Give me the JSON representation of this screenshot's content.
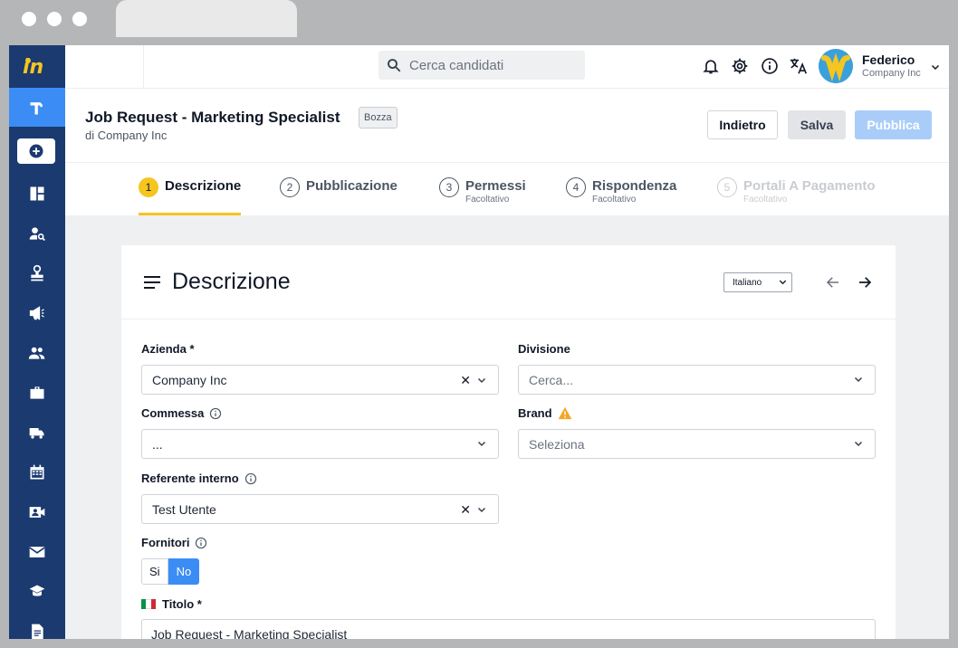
{
  "header": {
    "title": "Job Request - Marketing Specialist",
    "status": "Bozza",
    "subtitle": "di Company Inc",
    "buttons": {
      "back": "Indietro",
      "save": "Salva",
      "publish": "Pubblica"
    }
  },
  "topbar": {
    "search_placeholder": "Cerca candidati",
    "user_name": "Federico",
    "user_company": "Company Inc"
  },
  "steps": [
    {
      "num": "1",
      "label": "Descrizione",
      "sublabel": "",
      "state": "active"
    },
    {
      "num": "2",
      "label": "Pubblicazione",
      "sublabel": "",
      "state": "normal"
    },
    {
      "num": "3",
      "label": "Permessi",
      "sublabel": "Facoltativo",
      "state": "normal"
    },
    {
      "num": "4",
      "label": "Rispondenza",
      "sublabel": "Facoltativo",
      "state": "normal"
    },
    {
      "num": "5",
      "label": "Portali A Pagamento",
      "sublabel": "Facoltativo",
      "state": "disabled"
    }
  ],
  "card": {
    "title": "Descrizione",
    "language": "Italiano"
  },
  "form": {
    "azienda": {
      "label": "Azienda *",
      "value": "Company Inc"
    },
    "divisione": {
      "label": "Divisione",
      "placeholder": "Cerca..."
    },
    "commessa": {
      "label": "Commessa",
      "value": "..."
    },
    "brand": {
      "label": "Brand",
      "placeholder": "Seleziona"
    },
    "referente": {
      "label": "Referente interno",
      "value": "Test Utente"
    },
    "fornitori": {
      "label": "Fornitori",
      "option_yes": "Si",
      "option_no": "No",
      "selected": "No"
    },
    "titolo": {
      "label": "Titolo *",
      "value": "Job Request - Marketing Specialist"
    }
  },
  "colors": {
    "sidebar": "#1b3a70",
    "accent": "#3b8df5",
    "step_active": "#f5c520",
    "warning": "#f5a623"
  },
  "icons": {
    "sidebar": [
      "logo-icon",
      "hammer-icon",
      "add-icon",
      "dashboard-icon",
      "search-user-icon",
      "stamp-icon",
      "megaphone-icon",
      "people-icon",
      "briefcase-icon",
      "truck-icon",
      "calendar-icon",
      "video-contact-icon",
      "mail-icon",
      "school-icon",
      "document-icon"
    ],
    "topbar": [
      "search-icon",
      "bell-icon",
      "gear-icon",
      "info-icon",
      "translate-icon",
      "chevron-down-icon"
    ]
  }
}
